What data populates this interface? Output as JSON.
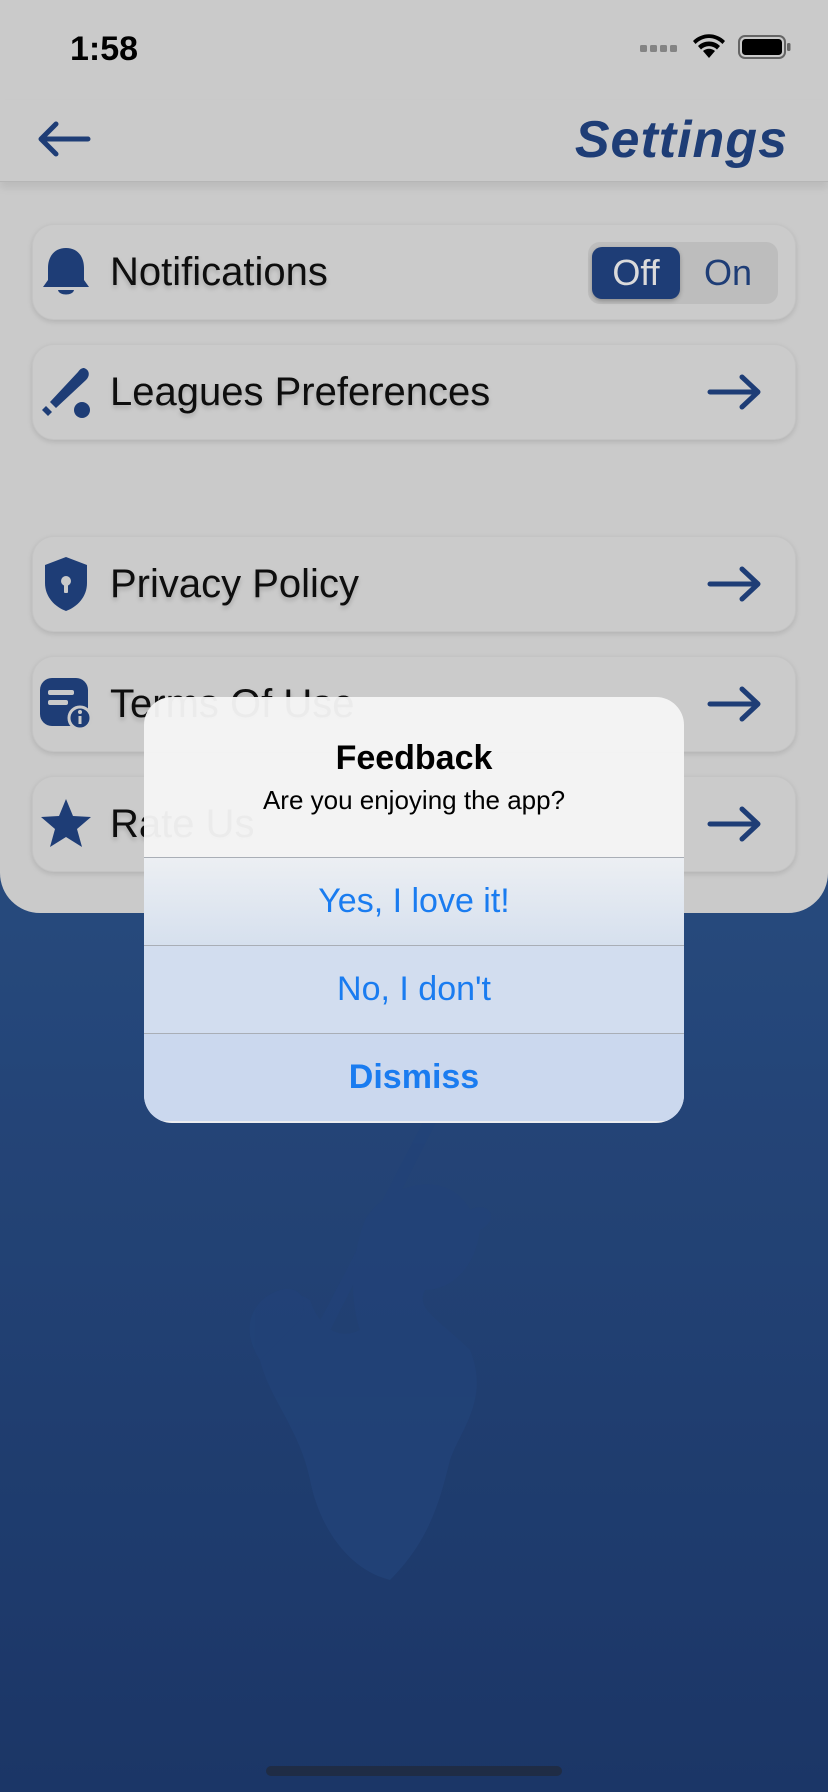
{
  "status_bar": {
    "time": "1:58"
  },
  "nav": {
    "title": "Settings"
  },
  "rows": [
    {
      "label": "Notifications",
      "icon": "bell-icon"
    },
    {
      "label": "Leagues Preferences",
      "icon": "baseball-bat-icon"
    },
    {
      "label": "Privacy Policy",
      "icon": "shield-lock-icon"
    },
    {
      "label": "Terms Of Use",
      "icon": "document-info-icon"
    },
    {
      "label": "Rate Us",
      "icon": "star-icon"
    }
  ],
  "notifications_toggle": {
    "off_label": "Off",
    "on_label": "On",
    "selected": "Off"
  },
  "alert": {
    "title": "Feedback",
    "message": "Are you enjoying the app?",
    "buttons": [
      "Yes, I love it!",
      "No, I don't",
      "Dismiss"
    ]
  },
  "colors": {
    "brand": "#24478a",
    "ios_blue": "#1a7cf0",
    "background_top": "#3a66a4",
    "background_bottom": "#203f78"
  }
}
